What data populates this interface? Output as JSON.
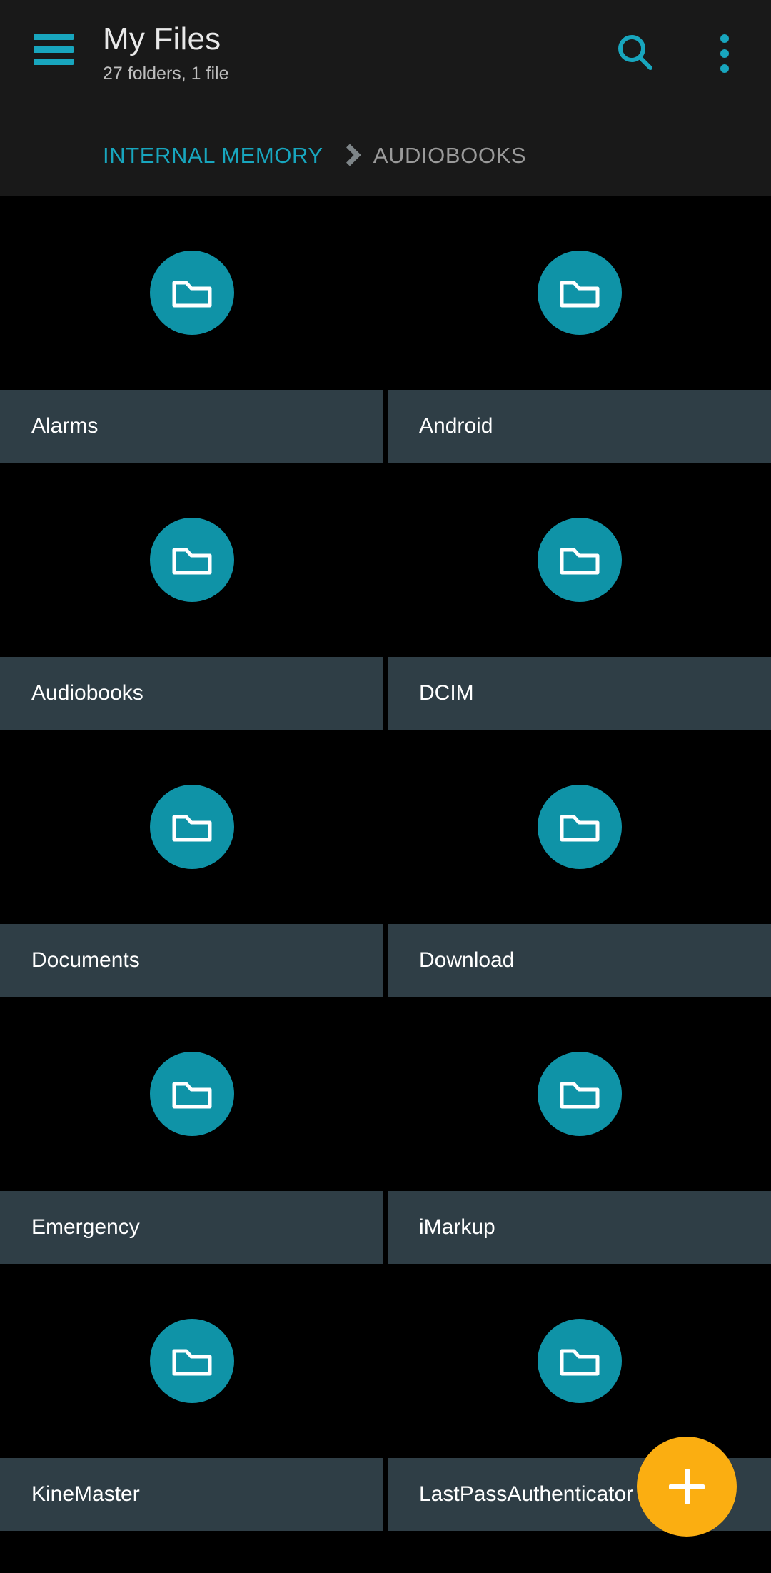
{
  "header": {
    "menu_icon": "hamburger-menu-icon",
    "title": "My Files",
    "subtitle": "27 folders, 1 file",
    "search_icon": "search-icon",
    "overflow_icon": "more-vertical-icon"
  },
  "breadcrumb": {
    "root": "INTERNAL MEMORY",
    "separator_icon": "chevron-right-icon",
    "current": "AUDIOBOOKS"
  },
  "colors": {
    "accent": "#18A6BE",
    "folder_circle": "#0F93A7",
    "label_bar": "#2F3E46",
    "appbar_bg": "#191919",
    "content_bg": "#000000",
    "fab": "#FBAE11",
    "title_text": "#E9E9E9",
    "subtitle_text": "#BFBFBF",
    "crumb_current": "#9A9A9A"
  },
  "grid": {
    "icon_name": "folder-icon",
    "rows": [
      [
        {
          "label": "Alarms",
          "icon": "folder-icon"
        },
        {
          "label": "Android",
          "icon": "folder-icon"
        }
      ],
      [
        {
          "label": "Audiobooks",
          "icon": "folder-icon"
        },
        {
          "label": "DCIM",
          "icon": "folder-icon"
        }
      ],
      [
        {
          "label": "Documents",
          "icon": "folder-icon"
        },
        {
          "label": "Download",
          "icon": "folder-icon"
        }
      ],
      [
        {
          "label": "Emergency",
          "icon": "folder-icon"
        },
        {
          "label": "iMarkup",
          "icon": "folder-icon"
        }
      ],
      [
        {
          "label": "KineMaster",
          "icon": "folder-icon"
        },
        {
          "label": "LastPassAuthenticator",
          "icon": "folder-icon"
        }
      ]
    ]
  },
  "fab": {
    "label": "+",
    "icon": "plus-icon"
  }
}
